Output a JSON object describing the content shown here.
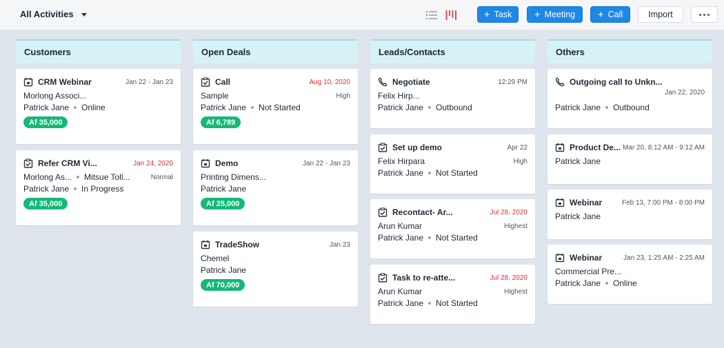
{
  "toolbar": {
    "view_label": "All Activities",
    "task_label": "Task",
    "meeting_label": "Meeting",
    "call_label": "Call",
    "import_label": "Import",
    "add_symbol": "+"
  },
  "colors": {
    "primary": "#1e88e5",
    "column_header": "#d6f2f6",
    "amount_badge": "#14b97a",
    "overdue_date": "#e32b2b",
    "kanban_icon": "#e84a4a",
    "board_background": "#dfe5ec"
  },
  "columns": [
    {
      "name": "Customers",
      "cards": [
        {
          "icon": "calendar-icon",
          "title": "CRM Webinar",
          "date": "Jan 22 - Jan 23",
          "line1": "Morlong Associ...",
          "owner": "Patrick Jane",
          "status": "Online",
          "amount": "Af 35,000"
        },
        {
          "icon": "task-check-icon",
          "title": "Refer CRM Vi...",
          "date": "Jan 24, 2020",
          "line1": "Morlong As...",
          "line1b": "Mitsue Toll...",
          "priority": "Normal",
          "owner": "Patrick Jane",
          "status": "In Progress",
          "amount": "Af 35,000"
        }
      ]
    },
    {
      "name": "Open Deals",
      "cards": [
        {
          "icon": "task-check-icon",
          "title": "Call",
          "date": "Aug 10, 2020",
          "line1": "Sample",
          "priority": "High",
          "owner": "Patrick Jane",
          "status": "Not Started",
          "amount": "Af 6,789"
        },
        {
          "icon": "calendar-icon",
          "title": "Demo",
          "date": "Jan 22 - Jan 23",
          "line1": "Printing Dimens...",
          "owner": "Patrick Jane",
          "amount": "Af 25,000"
        },
        {
          "icon": "calendar-icon",
          "title": "TradeShow",
          "date": "Jan 23",
          "line1": "Chemel",
          "owner": "Patrick Jane",
          "amount": "Af 70,000"
        }
      ]
    },
    {
      "name": "Leads/Contacts",
      "cards": [
        {
          "icon": "phone-icon",
          "title": "Negotiate",
          "date": "12:29 PM",
          "line1": "Felix Hirp...",
          "owner": "Patrick Jane",
          "status": "Outbound"
        },
        {
          "icon": "task-check-icon",
          "title": "Set up demo",
          "date": "Apr 22",
          "line1": "Felix Hirpara",
          "priority": "High",
          "owner": "Patrick Jane",
          "status": "Not Started"
        },
        {
          "icon": "task-check-icon",
          "title": "Recontact- Ar...",
          "date": "Jul 28, 2020",
          "line1": "Arun Kumar",
          "priority": "Highest",
          "owner": "Patrick Jane",
          "status": "Not Started"
        },
        {
          "icon": "task-check-icon",
          "title": "Task to re-atte...",
          "date": "Jul 28, 2020",
          "line1": "Arun Kumar",
          "priority": "Highest",
          "owner": "Patrick Jane",
          "status": "Not Started"
        }
      ]
    },
    {
      "name": "Others",
      "cards": [
        {
          "icon": "phone-icon",
          "title": "Outgoing call to Unkn...",
          "date": "Jan 22, 2020",
          "owner": "Patrick Jane",
          "status": "Outbound"
        },
        {
          "icon": "calendar-icon",
          "title": "Product De...",
          "date": "Mar 20, 8:12 AM - 9:12 AM",
          "owner": "Patrick Jane"
        },
        {
          "icon": "calendar-icon",
          "title": "Webinar",
          "date": "Feb 13, 7:00 PM - 8:00 PM",
          "owner": "Patrick Jane"
        },
        {
          "icon": "calendar-icon",
          "title": "Webinar",
          "date": "Jan 23, 1:25 AM - 2:25 AM",
          "line1": "Commercial Pre...",
          "owner": "Patrick Jane",
          "status": "Online"
        }
      ]
    }
  ]
}
